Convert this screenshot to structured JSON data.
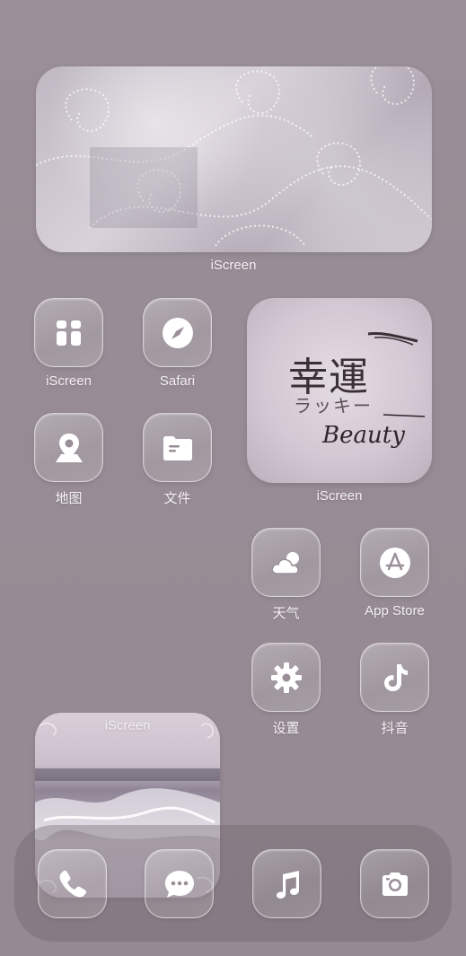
{
  "home": {
    "widget_wide": {
      "label": "iScreen"
    },
    "widget_lucky": {
      "label": "iScreen",
      "kanji": "幸運",
      "kana": "ラッキー",
      "script": "Beauty"
    },
    "widget_sea": {
      "label": "iScreen"
    },
    "apps": [
      {
        "id": "iscreen",
        "label": "iScreen",
        "icon": "iscreen-icon"
      },
      {
        "id": "safari",
        "label": "Safari",
        "icon": "compass-icon"
      },
      {
        "id": "maps",
        "label": "地图",
        "icon": "map-pin-icon"
      },
      {
        "id": "files",
        "label": "文件",
        "icon": "folder-icon"
      },
      {
        "id": "weather",
        "label": "天气",
        "icon": "cloud-icon"
      },
      {
        "id": "appstore",
        "label": "App Store",
        "icon": "app-store-icon"
      },
      {
        "id": "settings",
        "label": "设置",
        "icon": "gear-icon"
      },
      {
        "id": "douyin",
        "label": "抖音",
        "icon": "tiktok-icon"
      }
    ]
  },
  "dock": {
    "apps": [
      {
        "id": "phone",
        "icon": "phone-icon"
      },
      {
        "id": "messages",
        "icon": "message-icon"
      },
      {
        "id": "music",
        "icon": "music-note-icon"
      },
      {
        "id": "camera",
        "icon": "camera-icon"
      }
    ]
  },
  "colors": {
    "background": "#978c95",
    "glass_border": "#ffffff",
    "glyph": "#ffffff"
  }
}
